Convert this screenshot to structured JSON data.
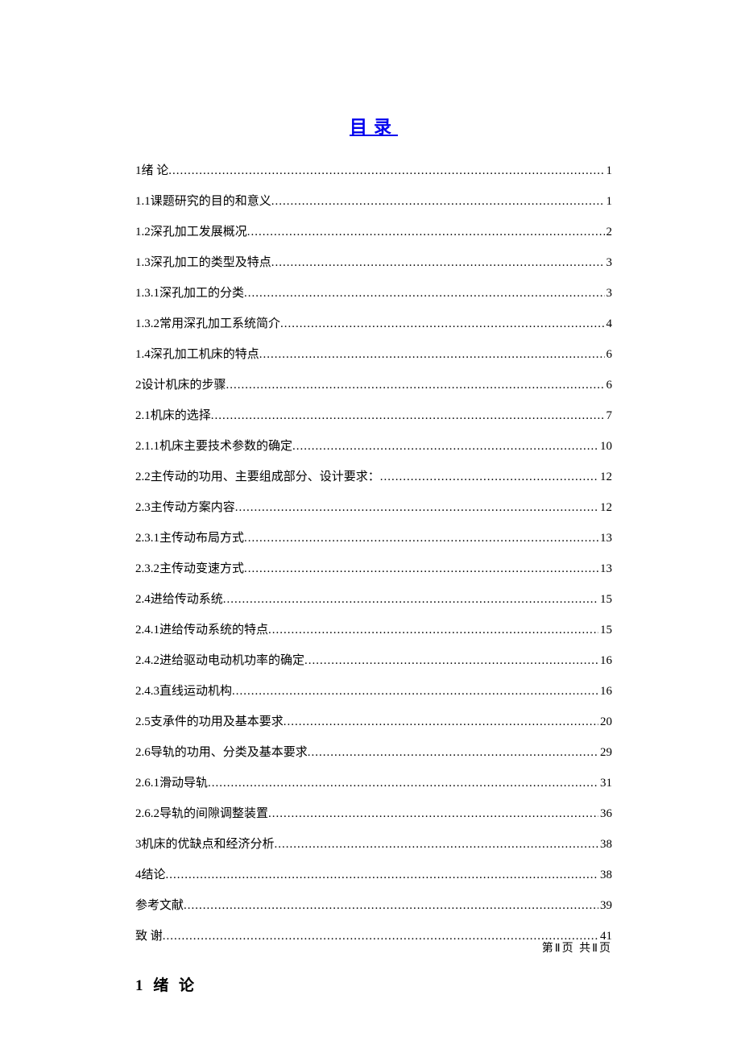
{
  "title": "目录",
  "toc": [
    {
      "num": "1",
      "text": "绪  论",
      "page": "1"
    },
    {
      "num": "1.1",
      "text": "课题研究的目的和意义",
      "page": "1"
    },
    {
      "num": "1.2",
      "text": "深孔加工发展概况",
      "page": "2"
    },
    {
      "num": "1.3",
      "text": "深孔加工的类型及特点",
      "page": "3"
    },
    {
      "num": "1.3.1",
      "text": "深孔加工的分类",
      "page": "3"
    },
    {
      "num": "1.3.2",
      "text": "常用深孔加工系统简介",
      "page": "4"
    },
    {
      "num": "1.4",
      "text": "深孔加工机床的特点",
      "page": "6"
    },
    {
      "num": "2",
      "text": "设计机床的步骤",
      "page": "6"
    },
    {
      "num": "2.1",
      "text": "机床的选择 ",
      "page": "7"
    },
    {
      "num": "2.1.1",
      "text": "机床主要技术参数的确定",
      "page": "10"
    },
    {
      "num": "2.2",
      "text": " 主传动的功用、主要组成部分、设计要求：",
      "page": "12"
    },
    {
      "num": "2.3",
      "text": "主传动方案内容",
      "page": "12"
    },
    {
      "num": "2.3.1",
      "text": "主传动布局方式",
      "page": "13"
    },
    {
      "num": "2.3.2",
      "text": "主传动变速方式",
      "page": "13"
    },
    {
      "num": "2.4",
      "text": "进给传动系统",
      "page": "15"
    },
    {
      "num": "2.4.1",
      "text": "进给传动系统的特点",
      "page": "15"
    },
    {
      "num": "2.4.2",
      "text": "进给驱动电动机功率的确定",
      "page": "16"
    },
    {
      "num": "2.4.3",
      "text": "直线运动机构",
      "page": "16"
    },
    {
      "num": "2.5",
      "text": "支承件的功用及基本要求",
      "page": "20"
    },
    {
      "num": "2.6",
      "text": "导轨的功用、分类及基本要求",
      "page": "29"
    },
    {
      "num": "2.6.1",
      "text": "滑动导轨",
      "page": "31"
    },
    {
      "num": "2.6.2",
      "text": "导轨的间隙调整装置",
      "page": "36"
    },
    {
      "num": "3",
      "text": " 机床的优缺点和经济分析",
      "page": "38"
    },
    {
      "num": "4",
      "text": "结论",
      "page": "38"
    },
    {
      "num": "",
      "text": "参考文献",
      "page": "39"
    },
    {
      "num": "",
      "text": "致  谢",
      "page": "41"
    }
  ],
  "section_heading": "1  绪  论",
  "footer": "第Ⅱ页  共Ⅱ页"
}
